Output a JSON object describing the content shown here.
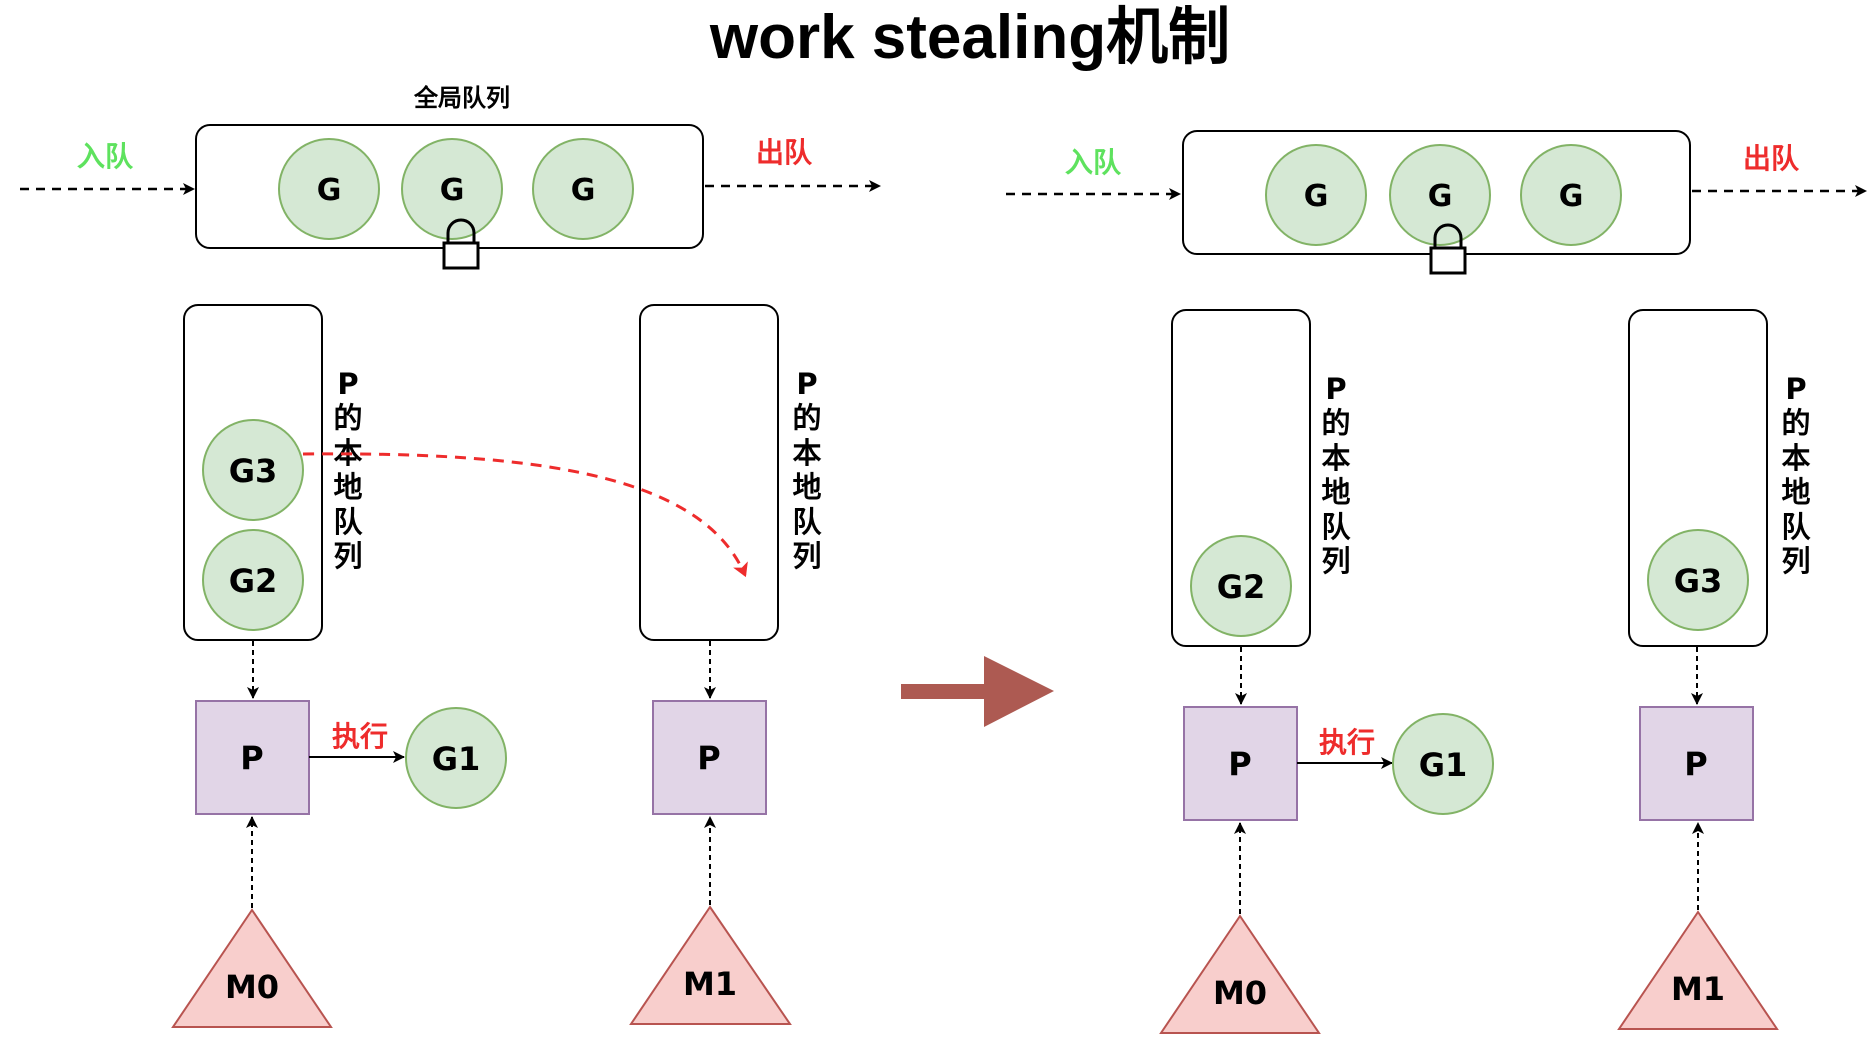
{
  "title": "work stealing机制",
  "global_queue": {
    "label": "全局队列",
    "items": [
      "G",
      "G",
      "G"
    ]
  },
  "enqueue_label": "入队",
  "dequeue_label": "出队",
  "local_queue_label": [
    "P",
    "的",
    "本",
    "地",
    "队",
    "列"
  ],
  "exec_label": "执行",
  "before": {
    "p0": {
      "processor": "P",
      "machine": "M0",
      "running": "G1",
      "local_queue": [
        "G3",
        "G2"
      ]
    },
    "p1": {
      "processor": "P",
      "machine": "M1",
      "local_queue": []
    }
  },
  "after": {
    "p0": {
      "processor": "P",
      "machine": "M0",
      "running": "G1",
      "local_queue": [
        "G2"
      ]
    },
    "p1": {
      "processor": "P",
      "machine": "M1",
      "local_queue": [
        "G3"
      ]
    }
  },
  "colors": {
    "goroutine_fill": "#d5e8d4",
    "goroutine_stroke": "#82b366",
    "processor_fill": "#e1d5e7",
    "processor_stroke": "#9673a6",
    "machine_fill": "#f8cecc",
    "machine_stroke": "#b85450",
    "enqueue": "#5ee25e",
    "dequeue": "#ee2c2c",
    "steal_arrow": "#ee2c2c",
    "transition_arrow": "#ad5a52"
  }
}
